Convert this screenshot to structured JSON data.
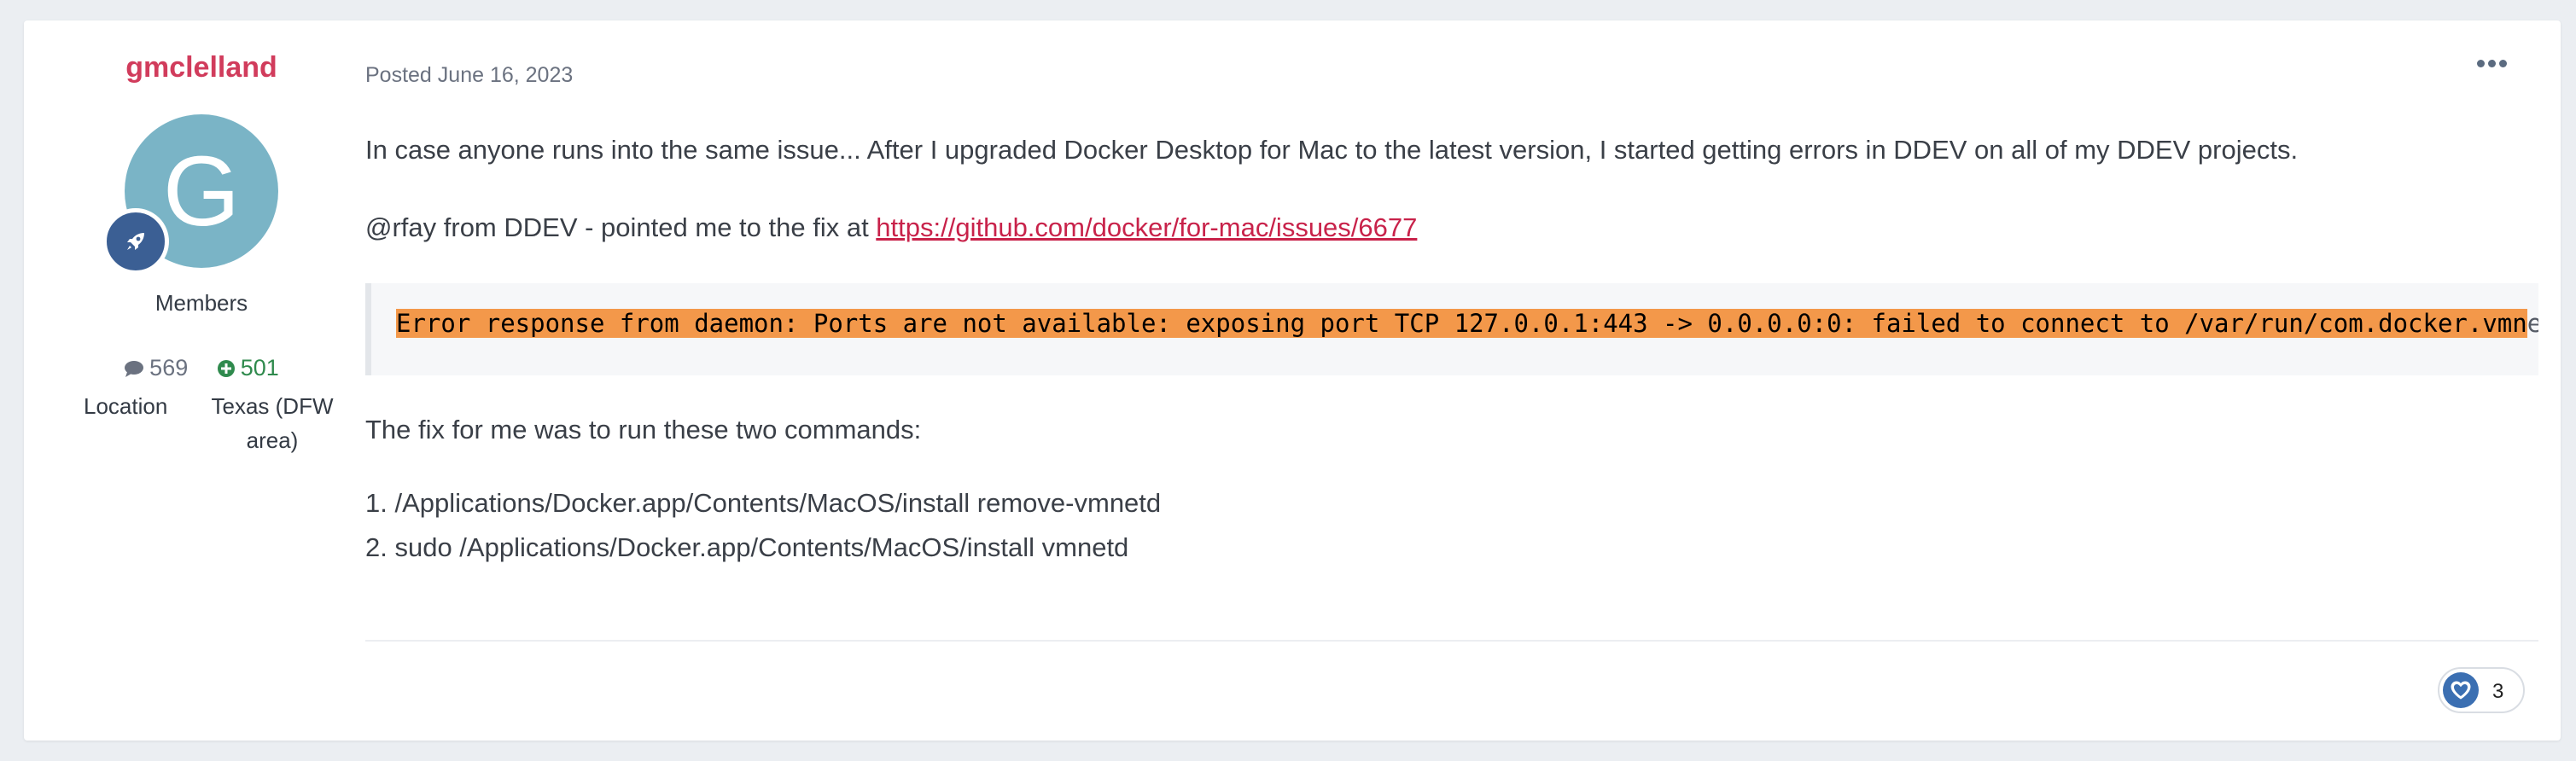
{
  "author": {
    "name": "gmclelland",
    "avatar_letter": "G",
    "avatar_color": "#7ab4c6",
    "rank_badge_icon": "rocket-icon",
    "group": "Members",
    "post_count": "569",
    "reputation": "501",
    "location_label": "Location",
    "location_value": "Texas (DFW area)"
  },
  "post": {
    "posted_prefix": "Posted",
    "posted_date": "June 16, 2023",
    "paragraph1": "In case anyone runs into the same issue...  After I upgraded Docker Desktop for Mac to the latest version, I started getting errors in DDEV on all of my DDEV projects.",
    "paragraph2_prefix": "@rfay from DDEV - pointed me to the fix at ",
    "paragraph2_link": "https://github.com/docker/for-mac/issues/6677",
    "code_highlighted": "Error response from daemon: Ports are not available: exposing port TCP 127.0.0.1:443 -> 0.0.0.0:0: failed to connect to /var/run/com.docker.vmn",
    "code_rest": "etd.sock",
    "paragraph3": "The fix for me was to run these two commands:",
    "steps": [
      "1. /Applications/Docker.app/Contents/MacOS/install remove-vmnetd",
      "2. sudo /Applications/Docker.app/Contents/MacOS/install vmnetd"
    ],
    "reaction_icon": "heart-icon",
    "reaction_count": "3"
  },
  "colors": {
    "author_name": "#d13c5c",
    "link": "#c8224a",
    "code_highlight": "#f3984a",
    "reputation": "#2f8a4d",
    "reaction": "#3b6fb2"
  }
}
